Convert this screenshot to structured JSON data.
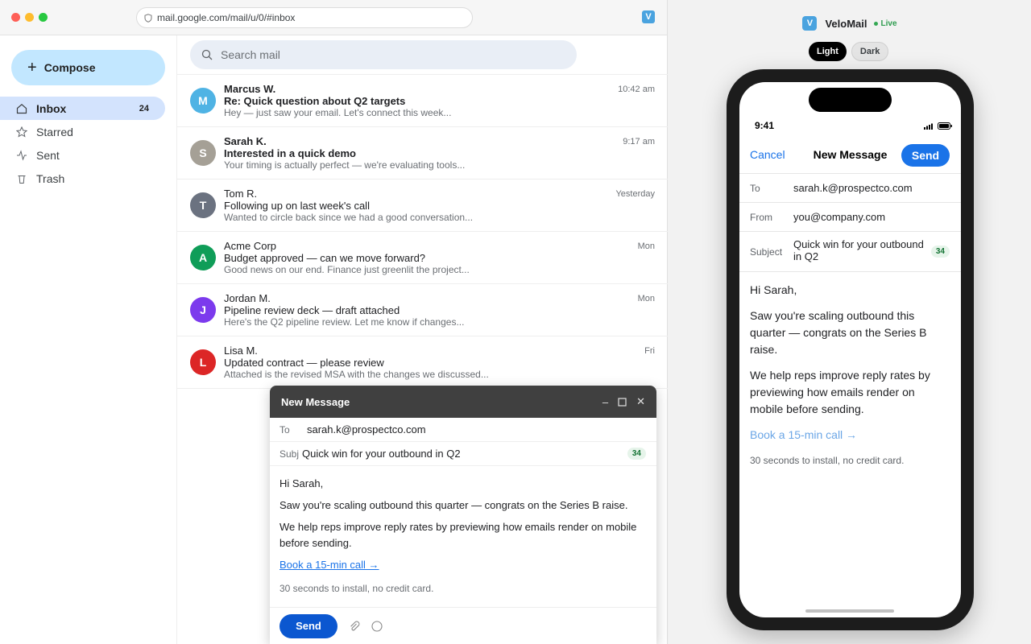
{
  "browser": {
    "url": "mail.google.com/mail/u/0/#inbox",
    "extension_label": "V"
  },
  "sidebar": {
    "compose_label": "Compose",
    "items": [
      {
        "label": "Inbox",
        "count": "24"
      },
      {
        "label": "Starred",
        "count": ""
      },
      {
        "label": "Sent",
        "count": ""
      },
      {
        "label": "Trash",
        "count": ""
      }
    ]
  },
  "search": {
    "placeholder": "Search mail"
  },
  "emails": [
    {
      "initial": "M",
      "color": "#4fb3e4",
      "sender": "Marcus W.",
      "subject": "Re: Quick question about Q2 targets",
      "preview": "Hey — just saw your email. Let's connect this week...",
      "time": "10:42 am",
      "unread": true
    },
    {
      "initial": "S",
      "color": "#a5a096",
      "sender": "Sarah K.",
      "subject": "Interested in a quick demo",
      "preview": "Your timing is actually perfect — we're evaluating tools...",
      "time": "9:17 am",
      "unread": true
    },
    {
      "initial": "T",
      "color": "#6b7280",
      "sender": "Tom R.",
      "subject": "Following up on last week's call",
      "preview": "Wanted to circle back since we had a good conversation...",
      "time": "Yesterday",
      "unread": false
    },
    {
      "initial": "A",
      "color": "#0f9d58",
      "sender": "Acme Corp",
      "subject": "Budget approved — can we move forward?",
      "preview": "Good news on our end. Finance just greenlit the project...",
      "time": "Mon",
      "unread": false
    },
    {
      "initial": "J",
      "color": "#7c3aed",
      "sender": "Jordan M.",
      "subject": "Pipeline review deck — draft attached",
      "preview": "Here's the Q2 pipeline review. Let me know if changes...",
      "time": "Mon",
      "unread": false
    },
    {
      "initial": "L",
      "color": "#dc2626",
      "sender": "Lisa M.",
      "subject": "Updated contract — please review",
      "preview": "Attached is the revised MSA with the changes we discussed...",
      "time": "Fri",
      "unread": false
    }
  ],
  "compose": {
    "title": "New Message",
    "to_label": "To",
    "to": "sarah.k@prospectco.com",
    "subject_label": "Subj",
    "subject": "Quick win for your outbound in Q2",
    "subject_count": "34",
    "greeting": "Hi Sarah,",
    "para1": "Saw you're scaling outbound this quarter — congrats on the Series B raise.",
    "para2": "We help reps improve reply rates by previewing how emails render on mobile before sending.",
    "link": "Book a 15-min call →",
    "footnote": "30 seconds to install, no credit card.",
    "send_label": "Send"
  },
  "preview_panel": {
    "brand": "VeloMail",
    "brand_logo": "V",
    "live_label": "Live",
    "theme_light": "Light",
    "theme_dark": "Dark",
    "phone": {
      "time": "9:41",
      "cancel": "Cancel",
      "title": "New Message",
      "send": "Send",
      "to_label": "To",
      "to": "sarah.k@prospectco.com",
      "from_label": "From",
      "from": "you@company.com",
      "subject_label": "Subject",
      "subject": "Quick win for your outbound in Q2",
      "subject_count": "34",
      "greeting": "Hi Sarah,",
      "para1": "Saw you're scaling outbound this quarter — congrats on the Series B raise.",
      "para2": "We help reps improve reply rates by previewing how emails render on mobile before sending.",
      "link": "Book a 15-min call →",
      "footnote": "30 seconds to install, no credit card."
    }
  }
}
